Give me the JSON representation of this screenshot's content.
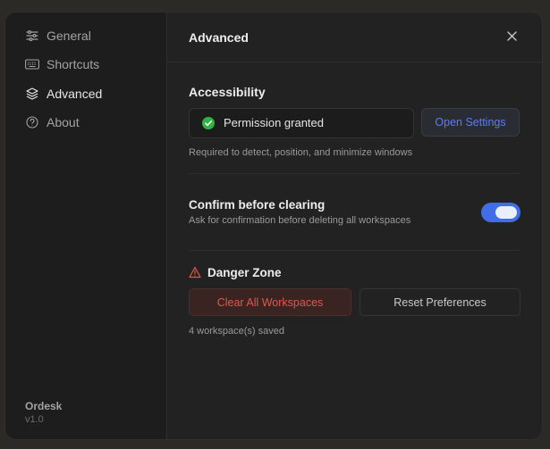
{
  "sidebar": {
    "items": [
      {
        "label": "General",
        "icon": "sliders-icon"
      },
      {
        "label": "Shortcuts",
        "icon": "keyboard-icon"
      },
      {
        "label": "Advanced",
        "icon": "layers-icon",
        "active": true
      },
      {
        "label": "About",
        "icon": "help-circle-icon"
      }
    ],
    "app_name": "Ordesk",
    "version": "v1.0"
  },
  "header": {
    "title": "Advanced"
  },
  "accessibility": {
    "title": "Accessibility",
    "status": "Permission granted",
    "open_settings_label": "Open Settings",
    "description": "Required to detect, position, and minimize windows"
  },
  "confirm": {
    "title": "Confirm before clearing",
    "description": "Ask for confirmation before deleting all workspaces",
    "enabled": true
  },
  "danger": {
    "title": "Danger Zone",
    "clear_label": "Clear All Workspaces",
    "reset_label": "Reset Preferences",
    "saved_text": "4 workspace(s) saved"
  },
  "colors": {
    "accent": "#3f6ee8",
    "success": "#2fb344",
    "danger": "#e0574f"
  }
}
